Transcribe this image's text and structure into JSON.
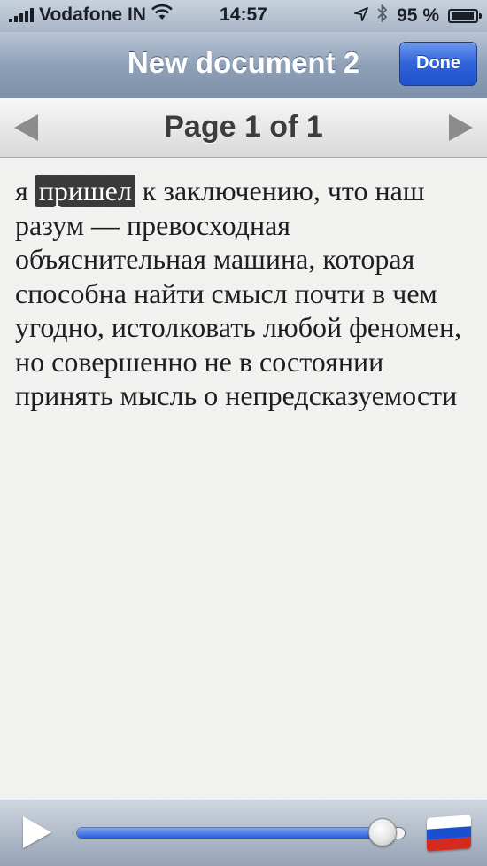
{
  "status_bar": {
    "carrier": "Vodafone IN",
    "time": "14:57",
    "battery": "95 %",
    "battery_level": 0.95,
    "icons": [
      "signal-icon",
      "wifi-icon",
      "location-arrow-icon",
      "bluetooth-icon",
      "battery-icon"
    ]
  },
  "nav": {
    "title": "New document 2",
    "done_label": "Done"
  },
  "pager": {
    "label": "Page 1 of 1",
    "prev_icon": "left-arrow-icon",
    "next_icon": "right-arrow-icon"
  },
  "document": {
    "before": "я ",
    "selected": "пришел",
    "after": " к заключению, что наш разум — превосходная объяснительная машина, которая способна найти смысл почти в чем угодно, истолковать любой феномен, но совершенно не в состоянии принять мысль о непредсказуемости"
  },
  "player": {
    "progress": 0.93,
    "language_flag": "russian-flag-icon",
    "flag_colors": [
      "#ffffff",
      "#1b4fd1",
      "#d52b1e"
    ]
  },
  "colors": {
    "accent": "#2f63d9",
    "selection": "#3a3a3a"
  }
}
